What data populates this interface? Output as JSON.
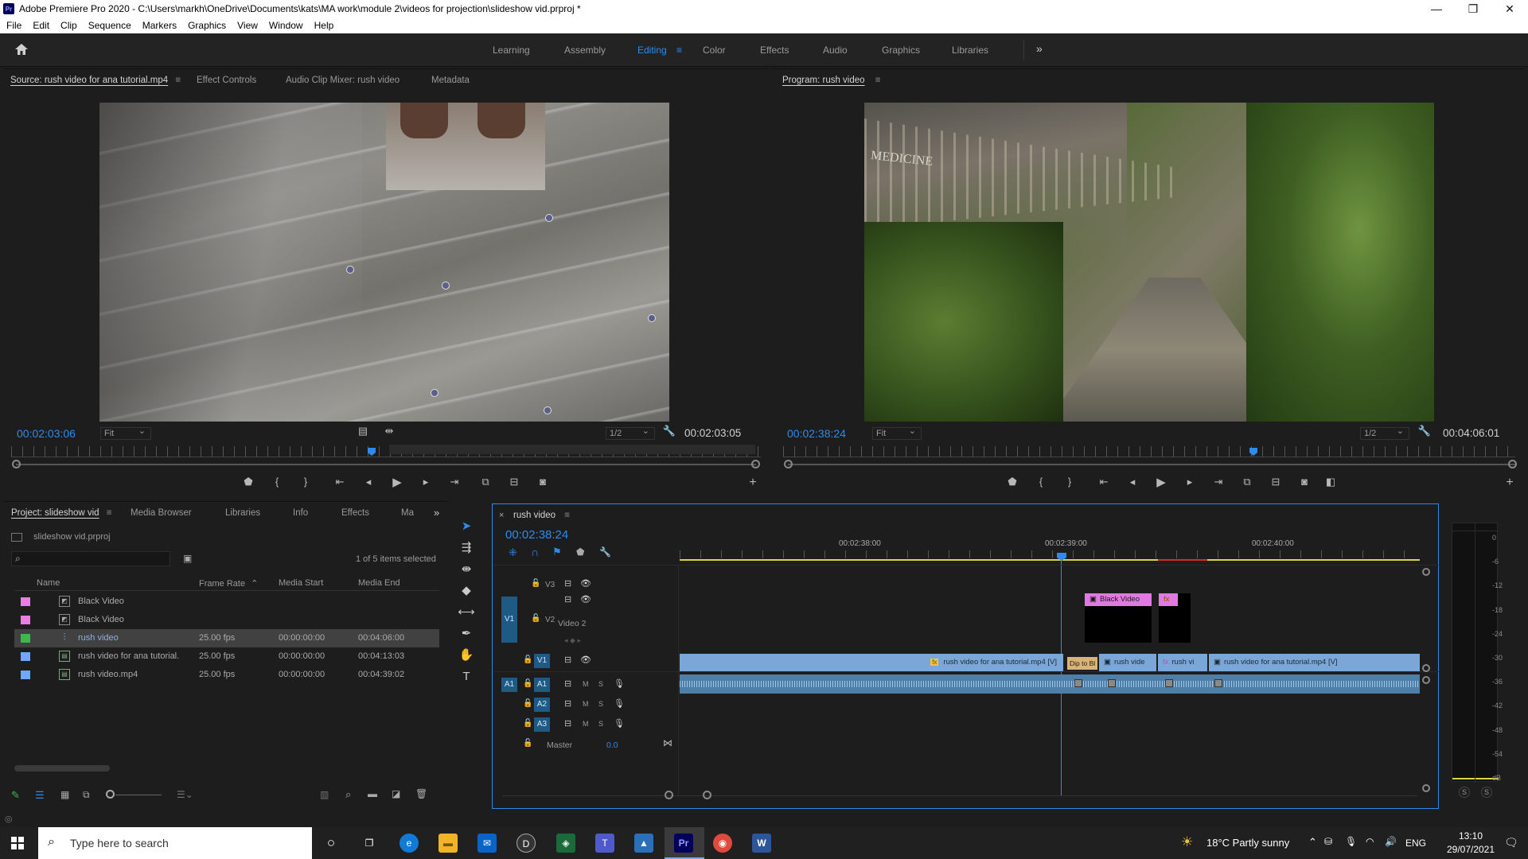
{
  "app": {
    "title": "Adobe Premiere Pro 2020 - C:\\Users\\markh\\OneDrive\\Documents\\kats\\MA work\\module 2\\videos for projection\\slideshow vid.prproj *",
    "icon_text": "Pr",
    "window_controls": [
      "—",
      "❐",
      "✕"
    ]
  },
  "menu": [
    "File",
    "Edit",
    "Clip",
    "Sequence",
    "Markers",
    "Graphics",
    "View",
    "Window",
    "Help"
  ],
  "workspaces": {
    "items": [
      "Learning",
      "Assembly",
      "Editing",
      "Color",
      "Effects",
      "Audio",
      "Graphics",
      "Libraries"
    ],
    "active": "Editing",
    "more": "»"
  },
  "source": {
    "tabs": [
      "Source: rush video for ana tutorial.mp4",
      "Effect Controls",
      "Audio Clip Mixer: rush video",
      "Metadata"
    ],
    "timecode": "00:02:03:06",
    "fit": "Fit",
    "resolution": "1/2",
    "duration": "00:02:03:05",
    "playhead_fraction": 0.48
  },
  "program": {
    "tab": "Program: rush video",
    "timecode": "00:02:38:24",
    "fit": "Fit",
    "resolution": "1/2",
    "duration": "00:04:06:01",
    "overlay_text": "MEDICINE",
    "playhead_fraction": 0.645
  },
  "project": {
    "tabs": [
      "Project: slideshow vid",
      "Media Browser",
      "Libraries",
      "Info",
      "Effects",
      "Ma"
    ],
    "file": "slideshow vid.prproj",
    "search_placeholder": "",
    "selection_status": "1 of 5 items selected",
    "columns": [
      "Name",
      "Frame Rate",
      "Media Start",
      "Media End"
    ],
    "items": [
      {
        "name": "Black Video",
        "frame_rate": "",
        "start": "",
        "end": "",
        "color": "#e87de8"
      },
      {
        "name": "Black Video",
        "frame_rate": "",
        "start": "",
        "end": "",
        "color": "#e87de8"
      },
      {
        "name": "rush video",
        "frame_rate": "25.00 fps",
        "start": "00:00:00:00",
        "end": "00:04:06:00",
        "color": "#3fb84a"
      },
      {
        "name": "rush video for ana tutorial.",
        "frame_rate": "25.00 fps",
        "start": "00:00:00:00",
        "end": "00:04:13:03",
        "color": "#6fa8ff"
      },
      {
        "name": "rush video.mp4",
        "frame_rate": "25.00 fps",
        "start": "00:00:00:00",
        "end": "00:04:39:02",
        "color": "#6fa8ff"
      }
    ]
  },
  "timeline": {
    "tab": "rush video",
    "timecode": "00:02:38:24",
    "ruler_labels": [
      "00:02:38:00",
      "00:02:39:00",
      "00:02:40:00"
    ],
    "tracks": {
      "v3": "V3",
      "v2": "V2",
      "v2_name": "Video 2",
      "v1": "V1",
      "a1": "A1",
      "a2": "A2",
      "a3": "A3",
      "source_v1": "V1",
      "source_a1": "A1",
      "master": "Master",
      "master_value": "0.0",
      "mute": "M",
      "solo": "S"
    },
    "clips": {
      "v2_black": "Black Video",
      "v2_fx": "fx",
      "v1_clip1": "rush video for ana tutorial.mp4 [V]",
      "v1_transition": "Dip to Bl",
      "v1_clip2": "rush vide",
      "v1_clip3": "rush vi",
      "v1_clip4": "rush video for ana tutorial.mp4 [V]"
    }
  },
  "meter": {
    "labels": [
      "0",
      "-6",
      "-12",
      "-18",
      "-24",
      "-30",
      "-36",
      "-42",
      "-48",
      "-54",
      "dB"
    ],
    "solo": [
      "S",
      "S"
    ]
  },
  "taskbar": {
    "search_placeholder": "Type here to search",
    "weather": "18°C  Partly sunny",
    "lang": "ENG",
    "time": "13:10",
    "date": "29/07/2021",
    "apps": [
      {
        "name": "cortana",
        "glyph": "○",
        "color": "#202020"
      },
      {
        "name": "task-view",
        "glyph": "❐",
        "color": "#202020"
      },
      {
        "name": "edge",
        "glyph": "e",
        "color": "#0f7bd6"
      },
      {
        "name": "file-explorer",
        "glyph": "▬",
        "color": "#f0b429"
      },
      {
        "name": "mail",
        "glyph": "✉",
        "color": "#0a64c8"
      },
      {
        "name": "dell",
        "glyph": "D",
        "color": "#333333"
      },
      {
        "name": "app-green",
        "glyph": "◈",
        "color": "#1b6b3a"
      },
      {
        "name": "teams",
        "glyph": "T",
        "color": "#5059c9"
      },
      {
        "name": "photos",
        "glyph": "▲",
        "color": "#2a6fb8"
      },
      {
        "name": "premiere",
        "glyph": "Pr",
        "color": "#00005b"
      },
      {
        "name": "chrome",
        "glyph": "◉",
        "color": "#e04a3c"
      },
      {
        "name": "word",
        "glyph": "W",
        "color": "#2b579a"
      }
    ]
  }
}
